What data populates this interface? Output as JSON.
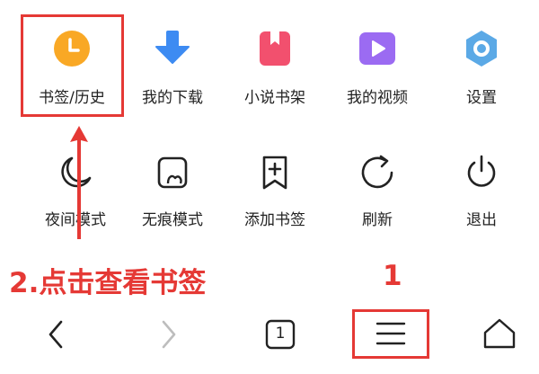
{
  "menu": {
    "row1": [
      {
        "label": "书签/历史",
        "icon": "bookmark-history-icon",
        "color": "#F9A825"
      },
      {
        "label": "我的下载",
        "icon": "download-icon",
        "color": "#3D8BF2"
      },
      {
        "label": "小说书架",
        "icon": "bookshelf-icon",
        "color": "#F2506E"
      },
      {
        "label": "我的视频",
        "icon": "video-icon",
        "color": "#9B6BF2"
      },
      {
        "label": "设置",
        "icon": "settings-icon",
        "color": "#5BA9E6"
      }
    ],
    "row2": [
      {
        "label": "夜间模式",
        "icon": "moon-icon"
      },
      {
        "label": "无痕模式",
        "icon": "incognito-icon"
      },
      {
        "label": "添加书签",
        "icon": "add-bookmark-icon"
      },
      {
        "label": "刷新",
        "icon": "refresh-icon"
      },
      {
        "label": "退出",
        "icon": "power-icon"
      }
    ]
  },
  "annotations": {
    "step2": "2.点击查看书签",
    "step1": "1",
    "color": "#E53935"
  },
  "bottom_nav": {
    "tab_count": "1",
    "items": [
      "back-icon",
      "forward-icon",
      "tabs-icon",
      "menu-icon",
      "home-icon"
    ]
  }
}
